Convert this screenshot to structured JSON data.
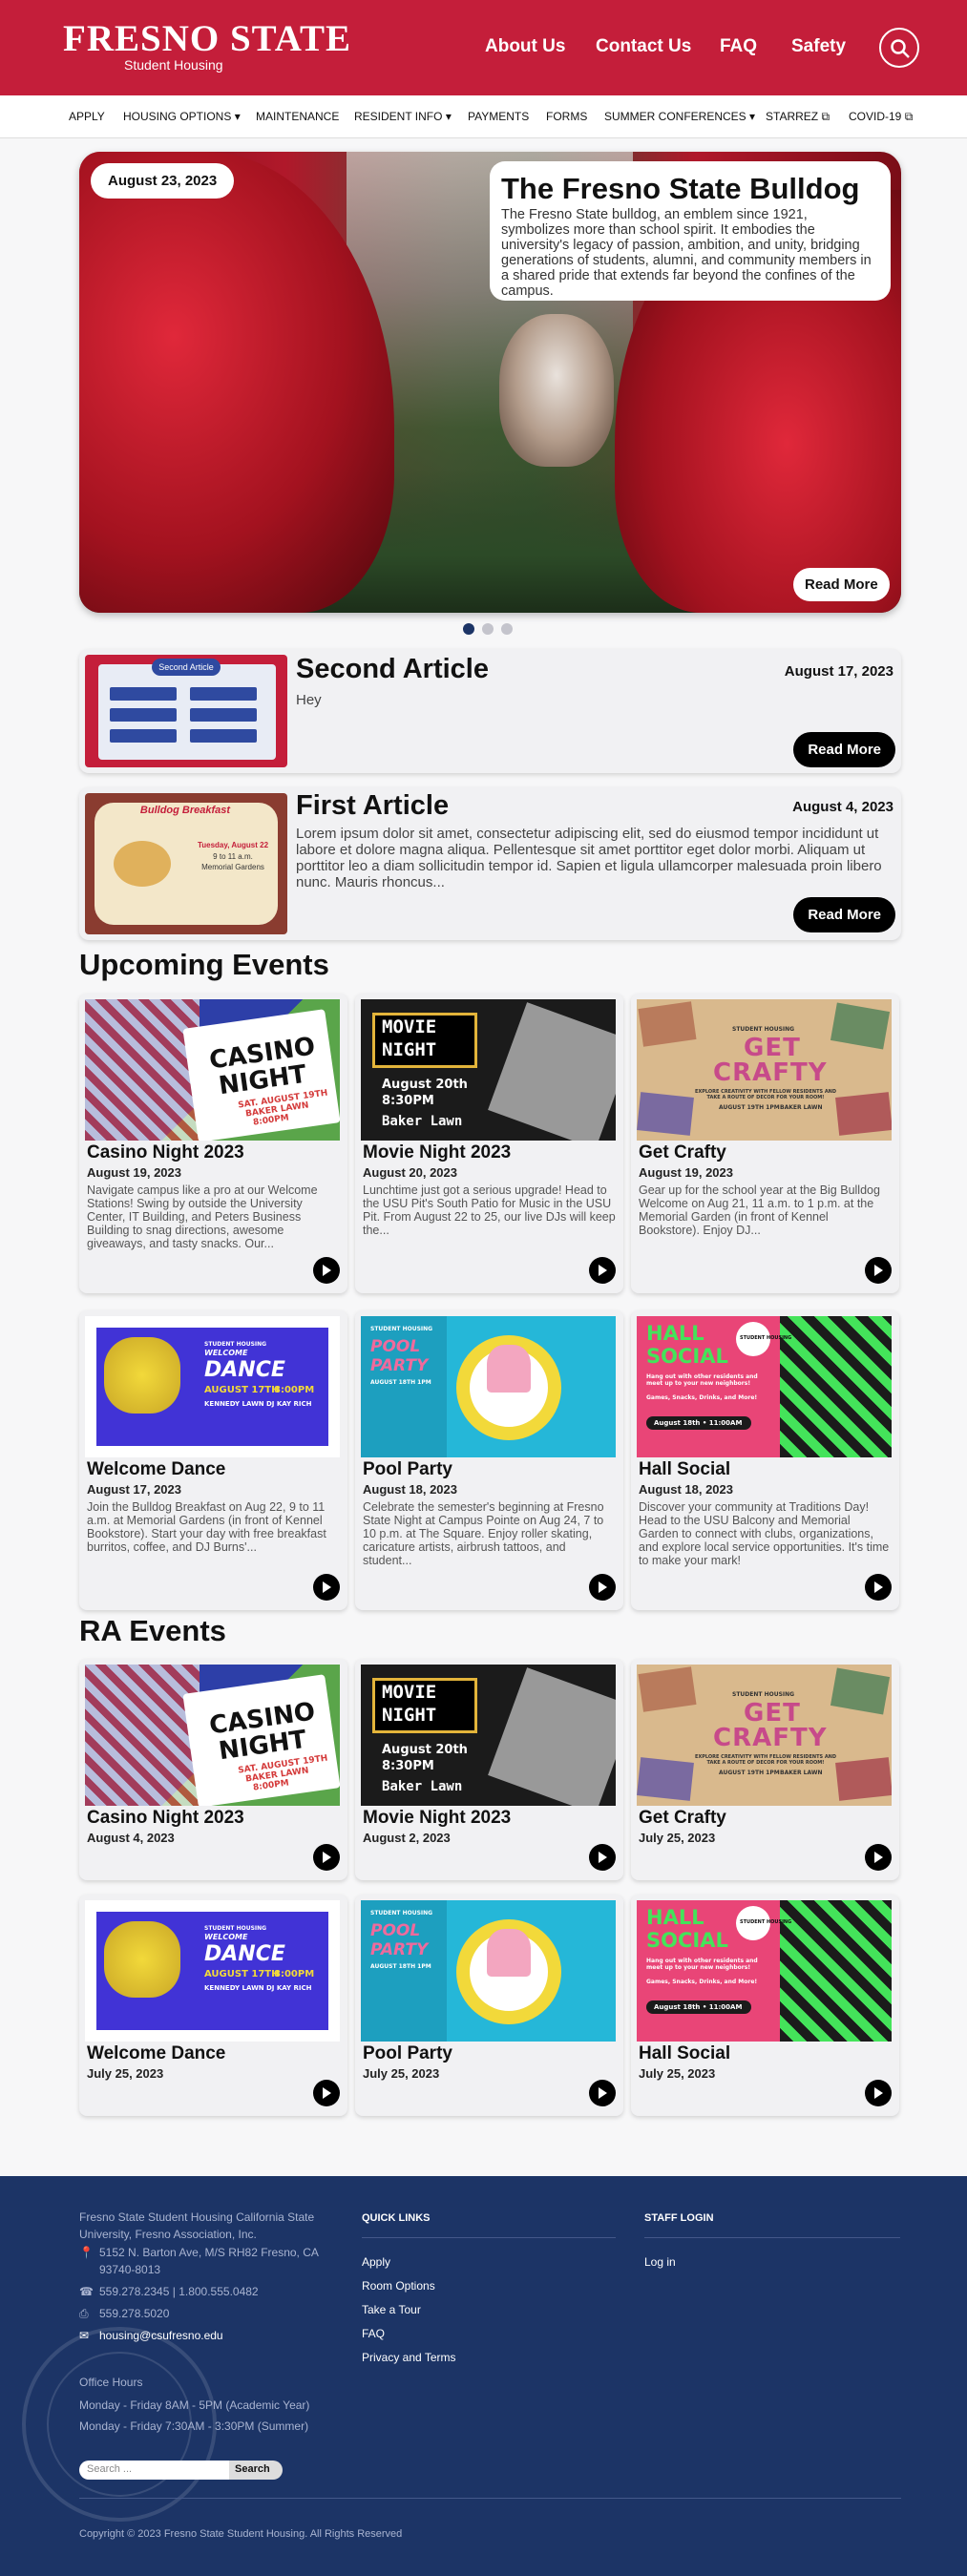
{
  "header": {
    "logo_main": "FRESNO STATE",
    "logo_sub": "Student Housing",
    "nav": [
      "About Us",
      "Contact Us",
      "FAQ",
      "Safety"
    ]
  },
  "subnav": [
    "APPLY",
    "HOUSING OPTIONS",
    "MAINTENANCE",
    "RESIDENT INFO",
    "PAYMENTS",
    "FORMS",
    "SUMMER CONFERENCES",
    "STARREZ",
    "COVID-19"
  ],
  "hero": {
    "date": "August 23, 2023",
    "title": "The Fresno State Bulldog",
    "text": "The Fresno State bulldog, an emblem since 1921, symbolizes more than school spirit. It embodies the university's legacy of passion, ambition, and unity, bridging generations of students, alumni, and community members in a shared pride that extends far beyond the confines of the campus.",
    "button": "Read More"
  },
  "articles": [
    {
      "title": "Second Article",
      "date": "August 17, 2023",
      "body": "Hey",
      "button": "Read More"
    },
    {
      "title": "First Article",
      "date": "August 4, 2023",
      "body": "Lorem ipsum dolor sit amet, consectetur adipiscing elit, sed do eiusmod tempor incididunt ut labore et dolore magna aliqua. Pellentesque sit amet porttitor eget dolor morbi. Aliquam ut porttitor leo a diam sollicitudin tempor id. Sapien et ligula ullamcorper malesuada proin libero nunc. Mauris rhoncus...",
      "button": "Read More"
    }
  ],
  "upcoming_title": "Upcoming Events",
  "upcoming": [
    {
      "title": "Casino Night 2023",
      "date": "August 19, 2023",
      "desc": "Navigate campus like a pro at our Welcome Stations! Swing by outside the University Center, IT Building, and Peters Business Building to snag directions, awesome giveaways, and tasty snacks. Our..."
    },
    {
      "title": "Movie Night 2023",
      "date": "August 20, 2023",
      "desc": "Lunchtime just got a serious upgrade! Head to the USU Pit's South Patio for Music in the USU Pit. From August 22 to 25, our live DJs will keep the..."
    },
    {
      "title": "Get Crafty",
      "date": "August 19, 2023",
      "desc": "Gear up for the school year at the Big Bulldog Welcome on Aug 21, 11 a.m. to 1 p.m. at the Memorial Garden (in front of Kennel Bookstore). Enjoy DJ..."
    },
    {
      "title": "Welcome Dance",
      "date": "August 17, 2023",
      "desc": "Join the Bulldog Breakfast on Aug 22, 9 to 11 a.m. at Memorial Gardens (in front of Kennel Bookstore). Start your day with free breakfast burritos, coffee, and DJ Burns'..."
    },
    {
      "title": "Pool Party",
      "date": "August 18, 2023",
      "desc": "Celebrate the semester's beginning at Fresno State Night at Campus Pointe on Aug 24, 7 to 10 p.m. at The Square. Enjoy roller skating, caricature artists, airbrush tattoos, and student..."
    },
    {
      "title": "Hall Social",
      "date": "August 18, 2023",
      "desc": "Discover your community at Traditions Day! Head to the USU Balcony and Memorial Garden to connect with clubs, organizations, and explore local service opportunities. It's time to make your mark!"
    }
  ],
  "ra_title": "RA Events",
  "ra": [
    {
      "title": "Casino Night 2023",
      "date": "August 4, 2023"
    },
    {
      "title": "Movie Night 2023",
      "date": "August 2, 2023"
    },
    {
      "title": "Get Crafty",
      "date": "July 25, 2023"
    },
    {
      "title": "Welcome Dance",
      "date": "July 25, 2023"
    },
    {
      "title": "Pool Party",
      "date": "July 25, 2023"
    },
    {
      "title": "Hall Social",
      "date": "July 25, 2023"
    }
  ],
  "posters": {
    "casino": [
      "CASINO",
      "NIGHT",
      "SAT. AUGUST 19TH",
      "BAKER LAWN",
      "8:00PM"
    ],
    "movie": [
      "MOVIE",
      "NIGHT",
      "August 20th",
      "8:30PM",
      "Baker Lawn"
    ],
    "crafty": [
      "STUDENT HOUSING",
      "GET",
      "CRAFTY",
      "EXPLORE CREATIVITY WITH FELLOW RESIDENTS AND TAKE A ROUTE OF DECOR FOR YOUR ROOM!",
      "AUGUST 19TH 1PM",
      "BAKER LAWN"
    ],
    "dance": [
      "STUDENT HOUSING",
      "WELCOME",
      "DANCE",
      "AUGUST 17TH",
      "8:00PM",
      "KENNEDY LAWN",
      "DJ KAY RICH"
    ],
    "pool": [
      "STUDENT HOUSING",
      "POOL",
      "PARTY",
      "AUGUST 18TH 1PM"
    ],
    "hall": [
      "HALL",
      "SOCIAL",
      "STUDENT HOUSING",
      "Hang out with other residents and meet up to your new neighbors!",
      "Games, Snacks, Drinks, and More!",
      "August 18th • 11:00AM"
    ],
    "second_article": [
      "Second Article"
    ],
    "first_article": [
      "Bulldog Breakfast",
      "Tuesday, August 22",
      "9 to 11 a.m.",
      "Memorial Gardens"
    ]
  },
  "footer": {
    "about": "Fresno State Student Housing California State University, Fresno Association, Inc.",
    "address": "5152 N. Barton Ave, M/S RH82 Fresno, CA 93740-8013",
    "phone": "559.278.2345 | 1.800.555.0482",
    "fax": "559.278.5020",
    "email": "housing@csufresno.edu",
    "hours_title": "Office Hours",
    "hours1": "Monday - Friday 8AM - 5PM (Academic Year)",
    "hours2": "Monday - Friday 7:30AM - 3:30PM (Summer)",
    "search_placeholder": "Search ...",
    "search_button": "Search",
    "quick_links_title": "QUICK LINKS",
    "quick_links": [
      "Apply",
      "Room Options",
      "Take a Tour",
      "FAQ",
      "Privacy and Terms"
    ],
    "staff_title": "STAFF LOGIN",
    "staff_link": "Log in",
    "copyright": "Copyright © 2023 Fresno State Student Housing. All Rights Reserved"
  },
  "colors": {
    "brand_red": "#c41e3a",
    "footer_navy": "#1c3466"
  }
}
